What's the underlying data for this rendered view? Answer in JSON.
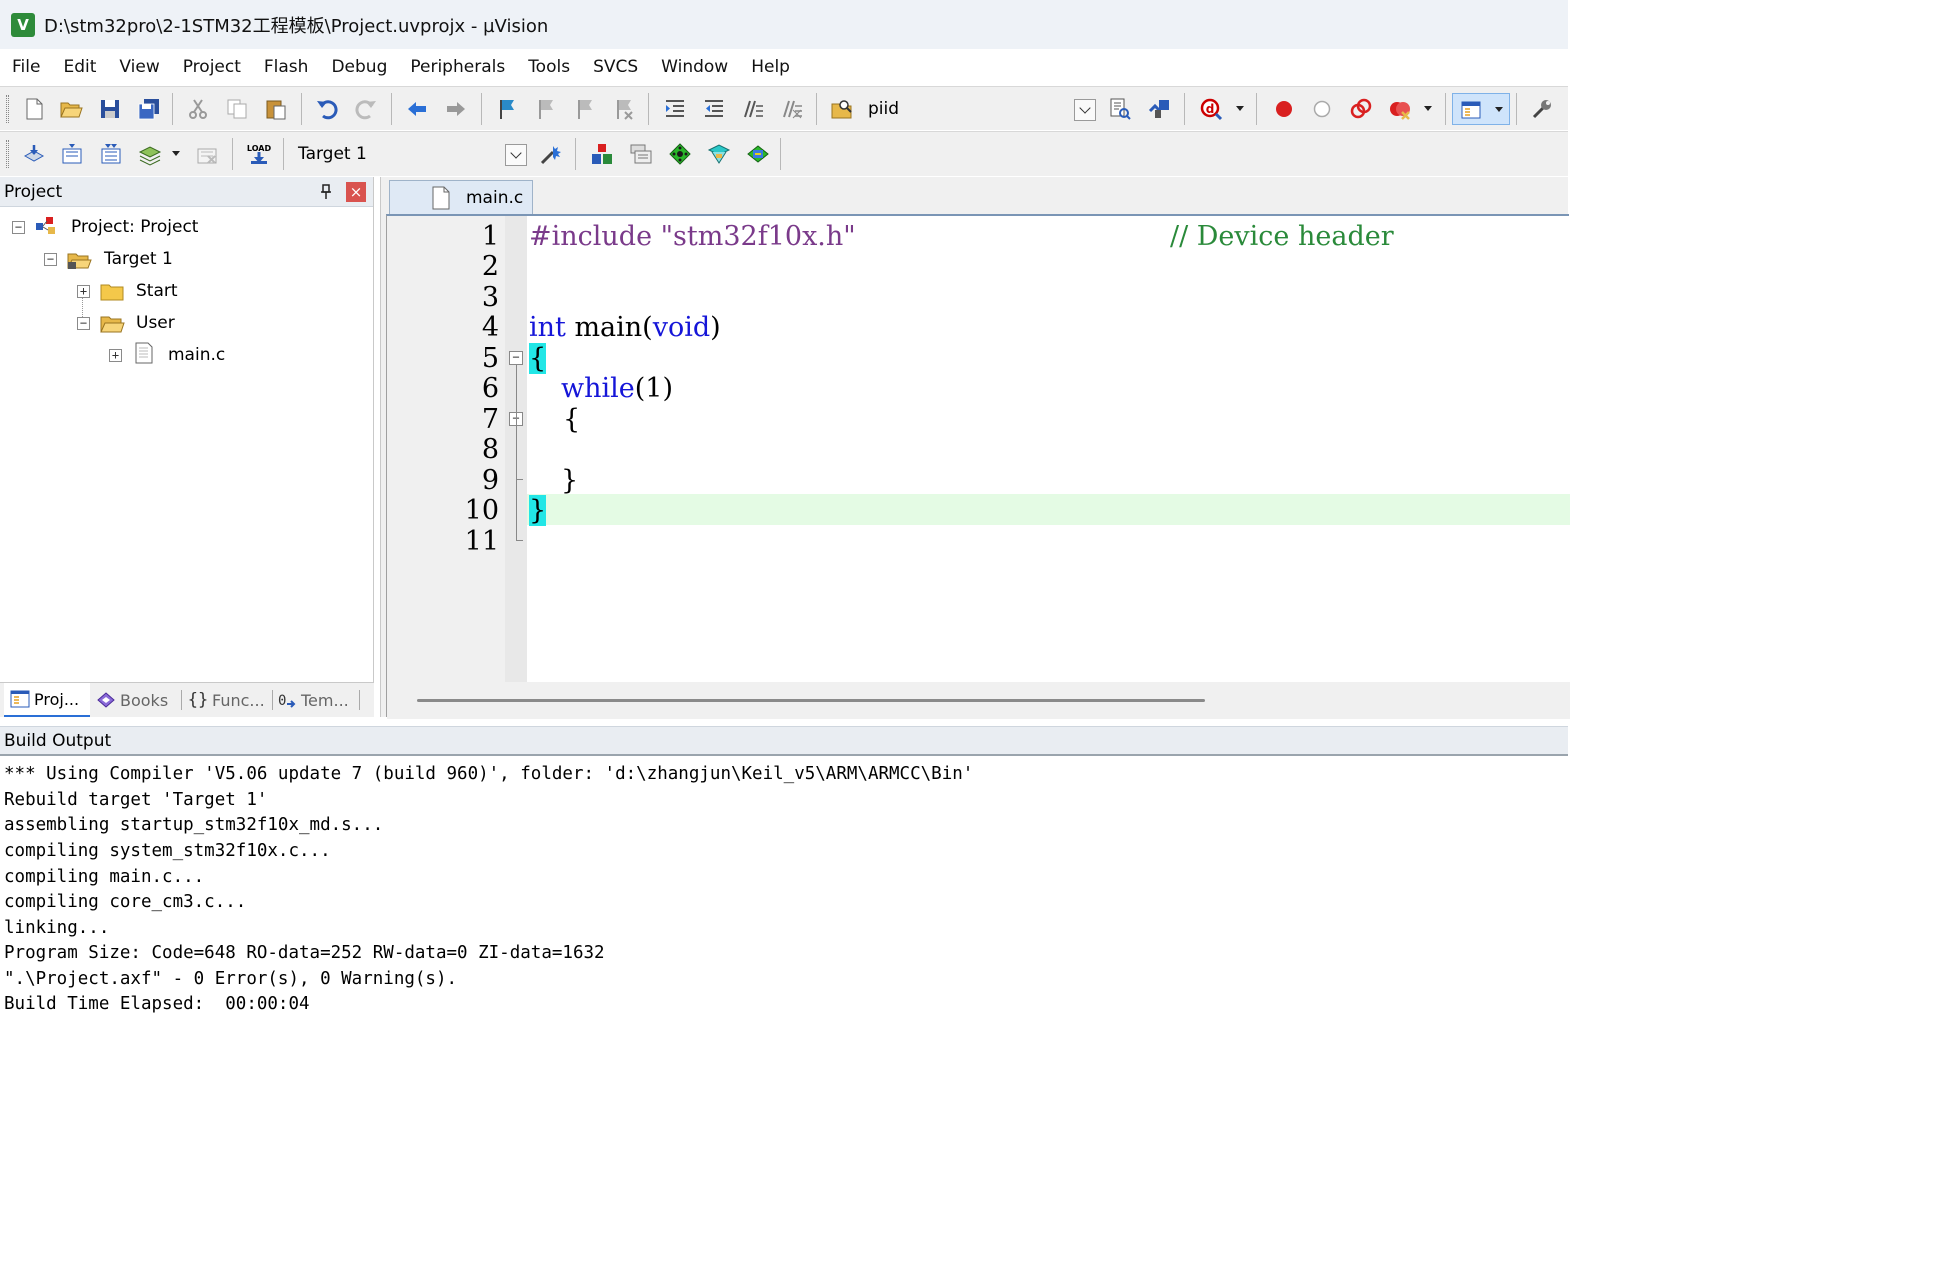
{
  "window": {
    "title": "D:\\stm32pro\\2-1STM32工程模板\\Project.uvprojx - µVision",
    "app_icon": "keil-uvision-icon"
  },
  "menu": [
    "File",
    "Edit",
    "View",
    "Project",
    "Flash",
    "Debug",
    "Peripherals",
    "Tools",
    "SVCS",
    "Window",
    "Help"
  ],
  "toolbar": {
    "find_value": "piid",
    "target_value": "Target 1"
  },
  "project_panel": {
    "title": "Project",
    "tree": {
      "root": "Project: Project",
      "target": "Target 1",
      "groups": [
        "Start",
        "User"
      ],
      "file": "main.c"
    },
    "tabs": [
      "Proj...",
      "Books",
      "Func...",
      "Tem..."
    ]
  },
  "editor": {
    "tab": "main.c",
    "line_numbers": [
      "1",
      "2",
      "3",
      "4",
      "5",
      "6",
      "7",
      "8",
      "9",
      "10",
      "11"
    ],
    "code": {
      "l1_pp": "#include ",
      "l1_str": "\"stm32f10x.h\"",
      "l1_cmt": "// Device header",
      "l4_kw1": "int",
      "l4_plain": " main(",
      "l4_kw2": "void",
      "l4_close": ")",
      "l5": "{",
      "l6_kw": "while",
      "l6_rest": "(1)",
      "l7": "{",
      "l9": "}",
      "l10": "}"
    },
    "current_line": 10
  },
  "build_output": {
    "title": "Build Output",
    "lines": [
      "*** Using Compiler 'V5.06 update 7 (build 960)', folder: 'd:\\zhangjun\\Keil_v5\\ARM\\ARMCC\\Bin'",
      "Rebuild target 'Target 1'",
      "assembling startup_stm32f10x_md.s...",
      "compiling system_stm32f10x.c...",
      "compiling main.c...",
      "compiling core_cm3.c...",
      "linking...",
      "Program Size: Code=648 RO-data=252 RW-data=0 ZI-data=1632",
      "\".\\Project.axf\" - 0 Error(s), 0 Warning(s).",
      "Build Time Elapsed:  00:00:04"
    ]
  }
}
